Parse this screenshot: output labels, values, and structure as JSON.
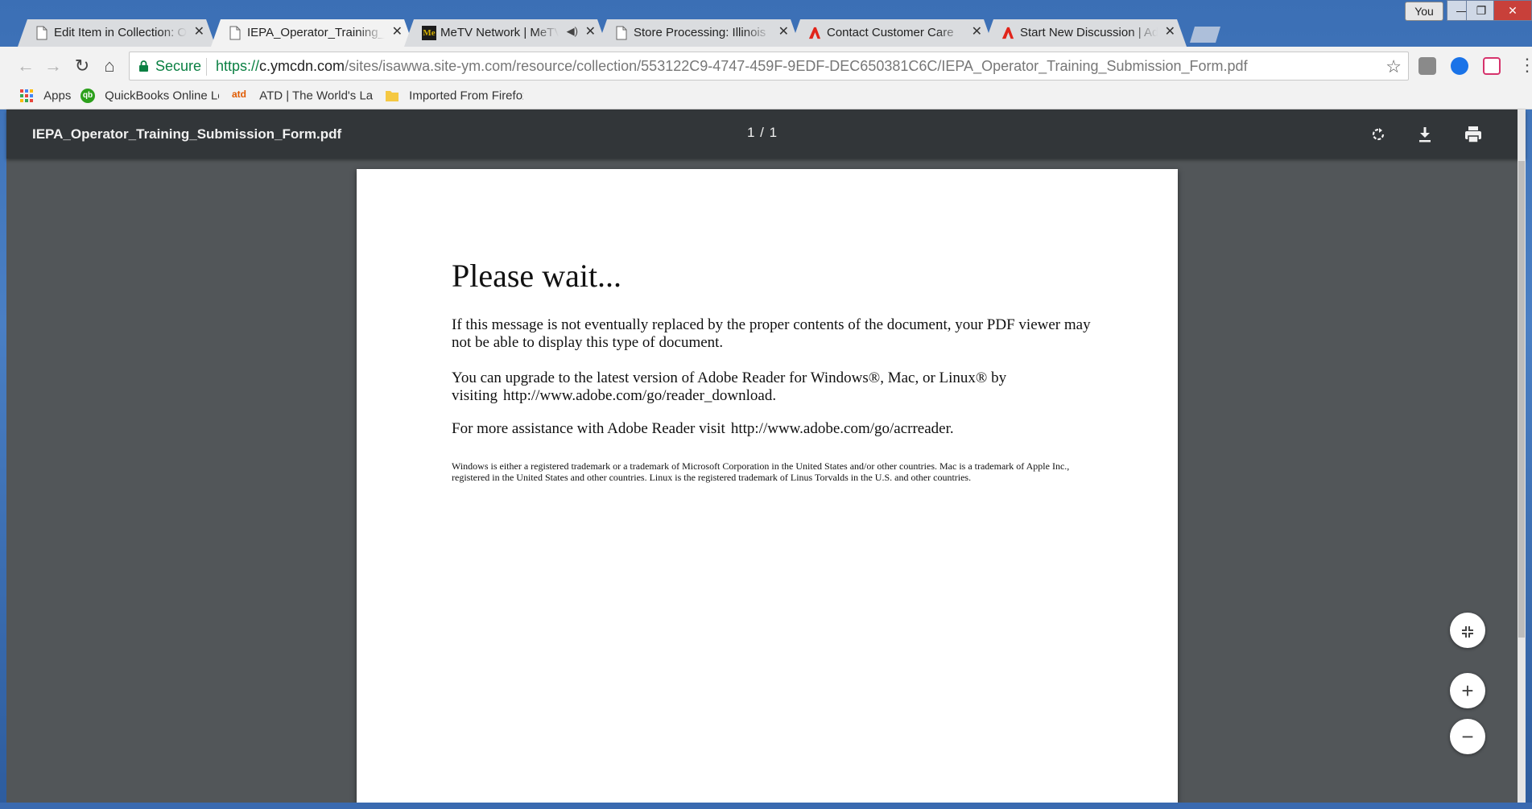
{
  "browser": {
    "profile_name": "You",
    "tabs": [
      {
        "title": "Edit Item in Collection: Operator Training",
        "icon": "page-icon"
      },
      {
        "title": "IEPA_Operator_Training_Submission_Form.pdf",
        "icon": "page-icon"
      },
      {
        "title": "MeTV Network | MeTV",
        "icon": "metv-icon"
      },
      {
        "title": "Store Processing: Illinois",
        "icon": "page-icon"
      },
      {
        "title": "Contact Customer Care",
        "icon": "adobe-icon"
      },
      {
        "title": "Start New Discussion | Adobe",
        "icon": "adobe-icon"
      }
    ],
    "metv_icon_text": "Me",
    "omnibox": {
      "secure_label": "Secure",
      "url_scheme": "https://",
      "url_host": "c.ymcdn.com",
      "url_path": "/sites/isawwa.site-ym.com/resource/collection/553122C9-4747-459F-9EDF-DEC650381C6C/IEPA_Operator_Training_Submission_Form.pdf"
    },
    "bookmarks": [
      {
        "label": "Apps"
      },
      {
        "label": "QuickBooks Online Login"
      },
      {
        "label": "ATD | The World's Largest"
      },
      {
        "label": "Imported From Firefox"
      }
    ],
    "qb_icon_text": "qb",
    "atd_icon_text": "atd"
  },
  "pdf_viewer": {
    "file_name": "IEPA_Operator_Training_Submission_Form.pdf",
    "page_indicator": "1 / 1"
  },
  "document": {
    "heading": "Please wait...",
    "para1": "If this message is not eventually replaced by the proper contents of the document, your PDF viewer may not be able to display this type of document.",
    "para2": "You can upgrade to the latest version of Adobe Reader for Windows®, Mac, or Linux® by visiting",
    "para2_link": "http://www.adobe.com/go/reader_download.",
    "para3": "For more assistance with Adobe Reader visit",
    "para3_link": "http://www.adobe.com/go/acrreader.",
    "fine_print": "Windows is either a registered trademark or a trademark of Microsoft Corporation in the United States and/or other countries. Mac is a trademark of Apple Inc., registered in the United States and other countries. Linux is the registered trademark of Linus Torvalds in the U.S. and other countries."
  },
  "colors": {
    "pdf_toolbar": "#323639",
    "viewer_bg": "#525659",
    "secure_green": "#0b8043"
  }
}
